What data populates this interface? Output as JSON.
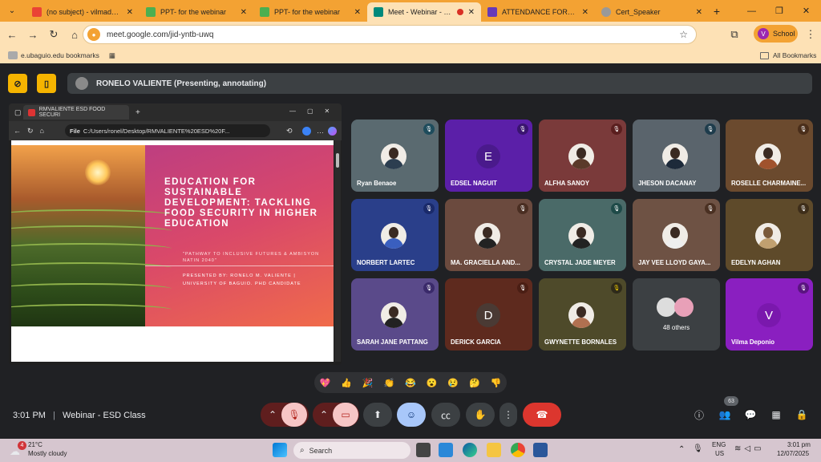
{
  "browser": {
    "tabs": [
      {
        "title": "(no subject) - vilmadeponi",
        "icon": "gmail-icon",
        "color": "#ea4335"
      },
      {
        "title": "PPT- for the webinar",
        "icon": "slides-icon",
        "color": "#f4b400"
      },
      {
        "title": "PPT- for the webinar",
        "icon": "slides-icon",
        "color": "#f4b400"
      },
      {
        "title": "Meet - Webinar - ESD",
        "icon": "meet-icon",
        "color": "#00897b"
      },
      {
        "title": "ATTENDANCE FORM FOR",
        "icon": "forms-icon",
        "color": "#673ab7"
      },
      {
        "title": "Cert_Speaker",
        "icon": "canva-icon",
        "color": "#999999"
      }
    ],
    "url": "meet.google.com/jid-yntb-uwq",
    "profile_label": "School",
    "profile_initial": "V",
    "bookmark_label": "e.ubaguio.edu bookmarks",
    "all_bookmarks": "All Bookmarks"
  },
  "meet": {
    "presenter_banner": "RONELO VALIENTE (Presenting, annotating)",
    "shared": {
      "tab_title": "RMVALIENTE ESD FOOD SECURI",
      "file_label": "File",
      "address": "C:/Users/ronel/Desktop/RMVALIENTE%20ESD%20F...",
      "slide_title": "EDUCATION FOR SUSTAINABLE DEVELOPMENT: TACKLING FOOD SECURITY IN HIGHER EDUCATION",
      "slide_subtitle": "\"PATHWAY TO INCLUSIVE FUTURES & AMBISYON NATIN 2040\"",
      "slide_byline": "PRESENTED BY: RONELO M. VALIENTE | UNIVERSITY OF BAGUIO. PHD CANDIDATE"
    },
    "participants": [
      {
        "name": "Ryan Benaoe"
      },
      {
        "name": "EDSEL NAGUIT",
        "initial": "E"
      },
      {
        "name": "ALFHA SANOY"
      },
      {
        "name": "JHESON DACANAY"
      },
      {
        "name": "ROSELLE CHARMAINE..."
      },
      {
        "name": "NORBERT LARTEC"
      },
      {
        "name": "MA. GRACIELLA AND..."
      },
      {
        "name": "CRYSTAL JADE MEYER"
      },
      {
        "name": "JAY VEE LLOYD GAYA..."
      },
      {
        "name": "EDELYN AGHAN"
      },
      {
        "name": "SARAH JANE PATTANG"
      },
      {
        "name": "DERICK GARCIA",
        "initial": "D"
      },
      {
        "name": "GWYNETTE BORNALES"
      },
      {
        "name": "48 others"
      },
      {
        "name": "Vilma Deponio",
        "initial": "V"
      }
    ],
    "reactions": [
      "💖",
      "👍",
      "🎉",
      "👏",
      "😂",
      "😮",
      "😢",
      "🤔",
      "👎"
    ],
    "time": "3:01 PM",
    "meeting_name": "Webinar - ESD Class",
    "people_count": "63"
  },
  "taskbar": {
    "weather_temp": "21°C",
    "weather_desc": "Mostly cloudy",
    "weather_badge": "4",
    "search_placeholder": "Search",
    "lang": "ENG",
    "region": "US",
    "clock_time": "3:01 pm",
    "clock_date": "12/07/2025"
  }
}
